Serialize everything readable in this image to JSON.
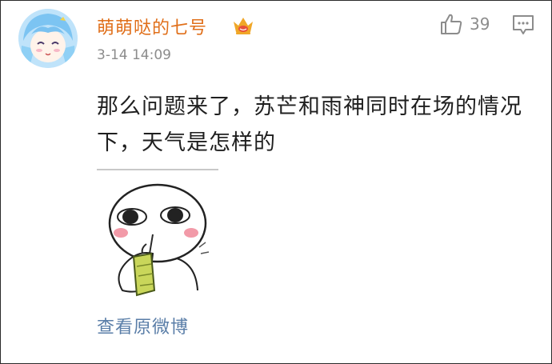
{
  "comment": {
    "username": "萌萌哒的七号",
    "badge_icon": "vip-crown-icon",
    "timestamp": "3-14 14:09",
    "like_count": "39",
    "text": "那么问题来了，苏芒和雨神同时在场的情况下，天气是怎样的",
    "view_original_label": "查看原微博"
  },
  "colors": {
    "username": "#e06f1a",
    "link": "#5a7ea8",
    "meta": "#8c8c8c",
    "text": "#1f1f1f"
  }
}
